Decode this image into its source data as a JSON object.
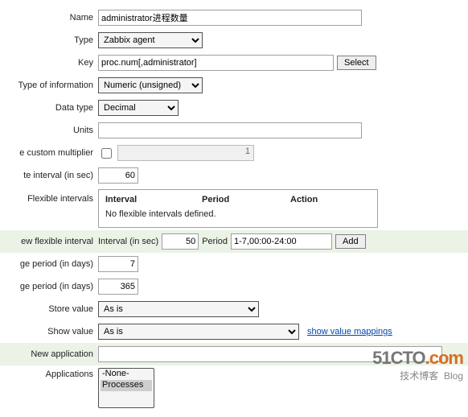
{
  "labels": {
    "name": "Name",
    "type": "Type",
    "key": "Key",
    "type_of_information": "Type of information",
    "data_type": "Data type",
    "units": "Units",
    "custom_multiplier": "e custom multiplier",
    "update_interval": "te interval (in sec)",
    "flexible_intervals": "Flexible intervals",
    "new_flexible_interval": "ew flexible interval",
    "history_period": "ge period (in days)",
    "trend_period": "ge period (in days)",
    "store_value": "Store value",
    "show_value": "Show value",
    "new_application": "New application",
    "applications": "Applications"
  },
  "values": {
    "name": "administrator进程数量",
    "key": "proc.num[,administrator]",
    "multiplier": "1",
    "update_interval": "60",
    "new_flex_interval": "50",
    "new_flex_period": "1-7,00:00-24:00",
    "history_days": "7",
    "trend_days": "365",
    "new_application": ""
  },
  "selects": {
    "type": "Zabbix agent",
    "type_of_information": "Numeric (unsigned)",
    "data_type": "Decimal",
    "store_value": "As is",
    "show_value": "As is"
  },
  "buttons": {
    "select": "Select",
    "add": "Add"
  },
  "flex_table": {
    "col_interval": "Interval",
    "col_period": "Period",
    "col_action": "Action",
    "empty_msg": "No flexible intervals defined."
  },
  "newflex": {
    "interval_label": "Interval (in sec)",
    "period_label": "Period"
  },
  "links": {
    "show_value_mappings": "show value mappings"
  },
  "applications_list": [
    "-None-",
    "Processes"
  ],
  "applications_selected": "Processes",
  "watermark": {
    "line0a": "51CTO",
    "line0b": ".com",
    "line1": "技术博客",
    "line2": "Blog"
  }
}
